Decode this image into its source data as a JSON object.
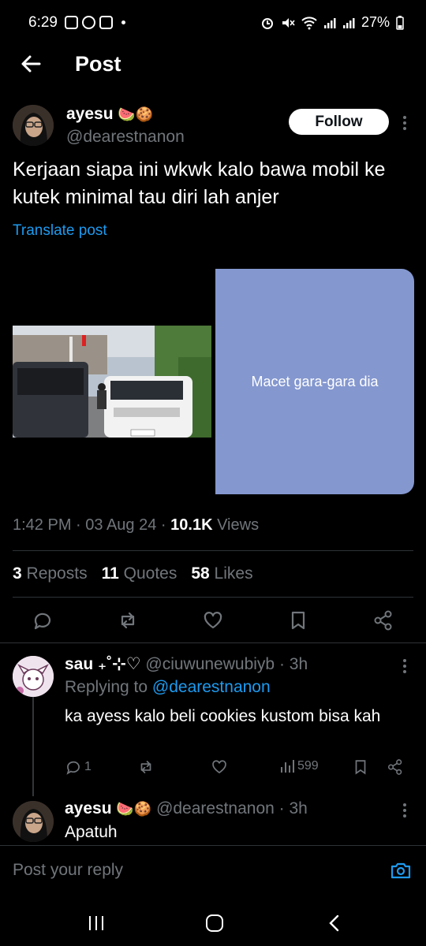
{
  "status": {
    "time": "6:29",
    "battery": "27%",
    "left_icons": [
      "gallery-icon",
      "whatsapp-icon",
      "bot-icon",
      "notification-dot"
    ],
    "right_icons": [
      "alarm-icon",
      "mute-icon",
      "wifi-icon",
      "signal-icon",
      "signal-icon-2",
      "battery-icon"
    ]
  },
  "header": {
    "title": "Post"
  },
  "post": {
    "author_name": "ayesu",
    "author_emojis": "🍉🍪",
    "handle": "@dearestnanon",
    "follow_label": "Follow",
    "text": "Kerjaan siapa ini wkwk kalo bawa mobil ke kutek minimal tau diri lah anjer",
    "translate_label": "Translate post",
    "card_text": "Macet gara-gara dia",
    "time": "1:42 PM",
    "date": "03 Aug 24",
    "views_count": "10.1K",
    "views_label": "Views",
    "reposts_count": "3",
    "reposts_label": "Reposts",
    "quotes_count": "11",
    "quotes_label": "Quotes",
    "likes_count": "58",
    "likes_label": "Likes"
  },
  "replies": [
    {
      "name": "sau ₊˚⊹♡",
      "handle": "@ciuwunewubiyb",
      "time": "3h",
      "replying_label": "Replying to",
      "replying_handle": "@dearestnanon",
      "text": "ka ayess kalo beli cookies kustom bisa kah",
      "reply_count": "1",
      "views": "599"
    },
    {
      "name": "ayesu",
      "emojis": "🍉🍪",
      "handle": "@dearestnanon",
      "time": "3h",
      "text": "Apatuh"
    }
  ],
  "composer": {
    "placeholder": "Post your reply"
  },
  "colors": {
    "accent": "#1d9bf0",
    "card": "#8497cf",
    "background": "#000000",
    "muted": "#71767b"
  }
}
